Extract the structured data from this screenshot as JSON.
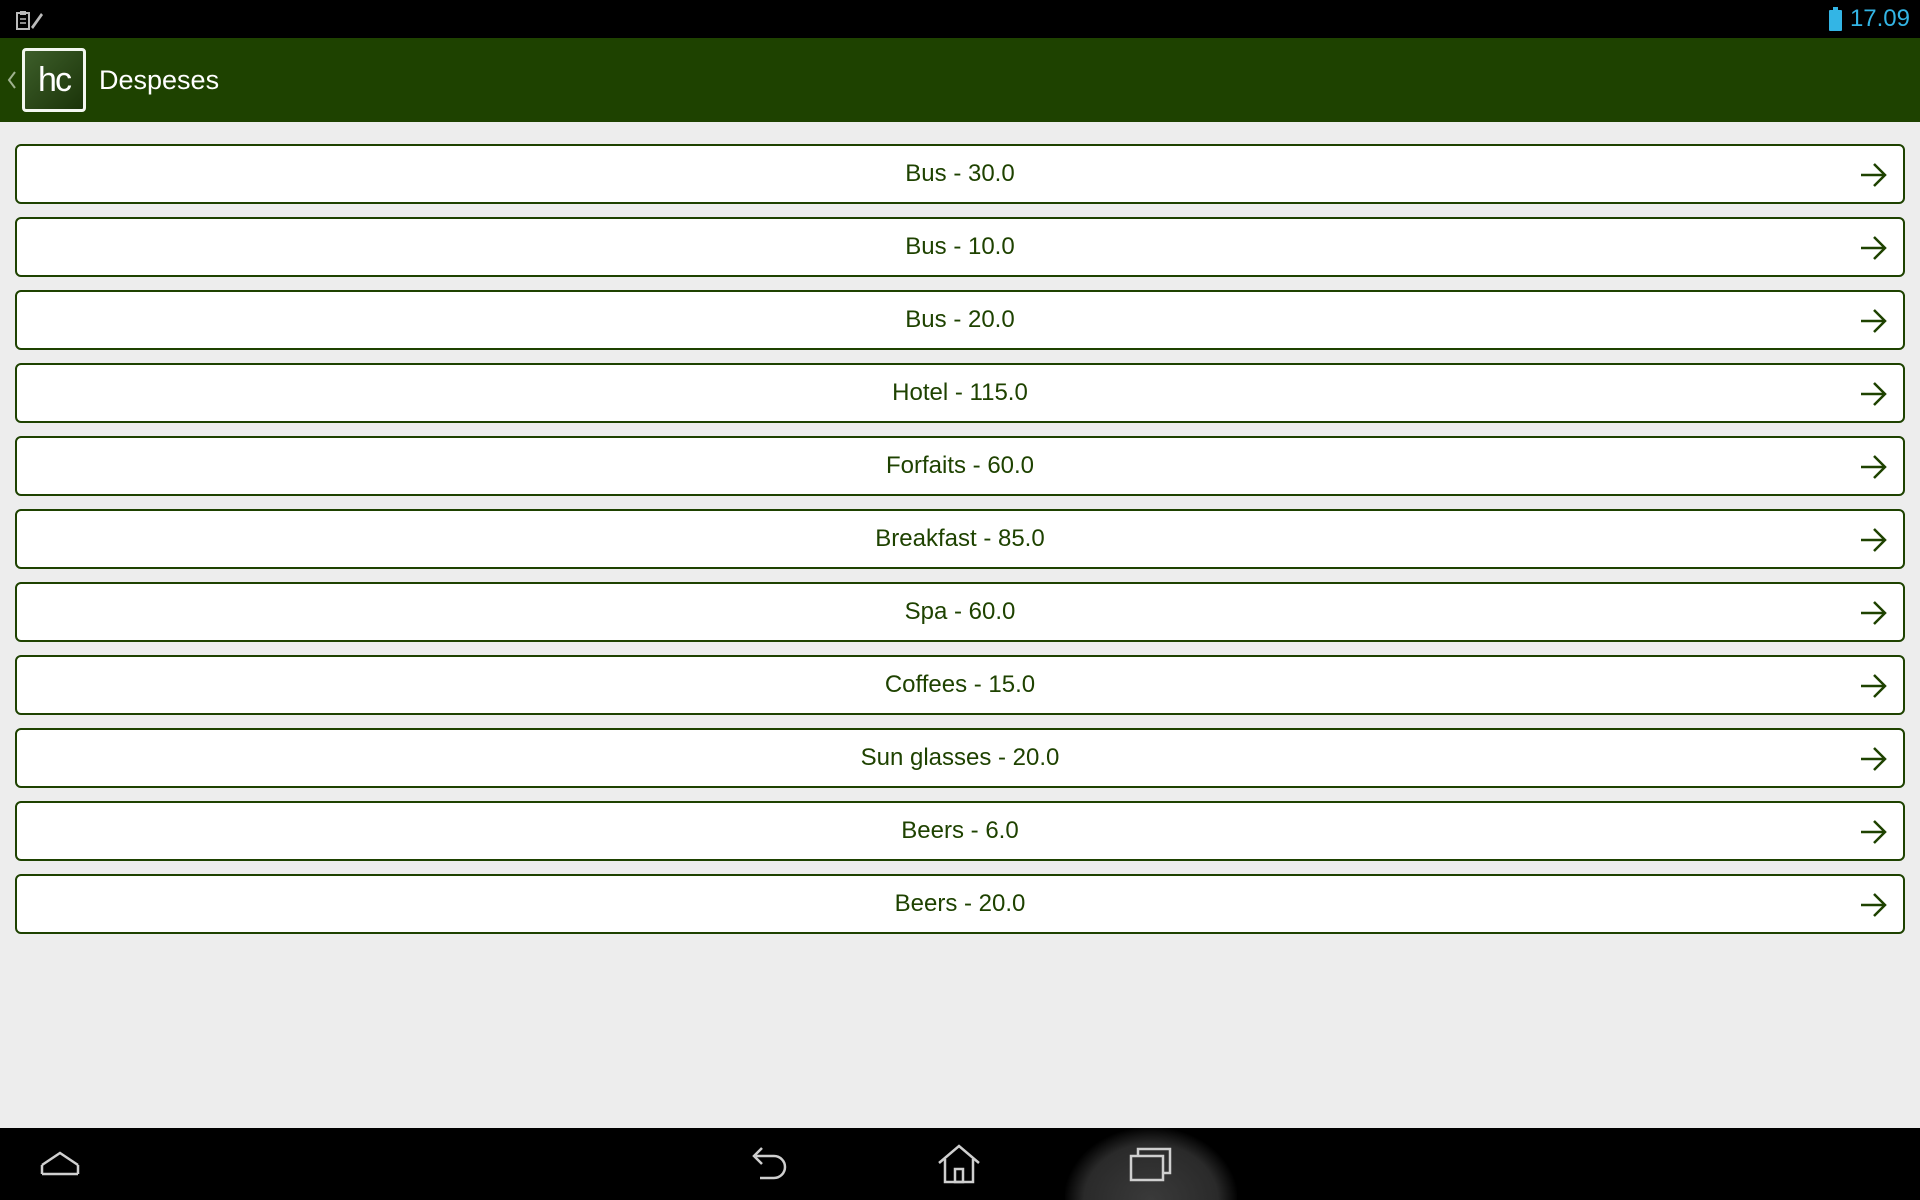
{
  "status_bar": {
    "time": "17.09",
    "left_icon": "clipboard-notification-icon",
    "battery_icon": "battery-icon",
    "accent_color": "#33b5e5"
  },
  "action_bar": {
    "title": "Despeses",
    "app_icon_text": "hc",
    "up_icon": "chevron-left-icon",
    "background_color": "#1e4200"
  },
  "expenses": [
    {
      "label": "Bus - 30.0"
    },
    {
      "label": "Bus - 10.0"
    },
    {
      "label": "Bus - 20.0"
    },
    {
      "label": "Hotel - 115.0"
    },
    {
      "label": "Forfaits - 60.0"
    },
    {
      "label": "Breakfast - 85.0"
    },
    {
      "label": "Spa - 60.0"
    },
    {
      "label": "Coffees - 15.0"
    },
    {
      "label": "Sun glasses - 20.0"
    },
    {
      "label": "Beers - 6.0"
    },
    {
      "label": "Beers - 20.0"
    }
  ],
  "list_item_icon": "arrow-right-icon",
  "nav_bar": {
    "buttons": [
      "hide-keyboard-icon",
      "back-icon",
      "home-icon",
      "recent-apps-icon"
    ]
  }
}
